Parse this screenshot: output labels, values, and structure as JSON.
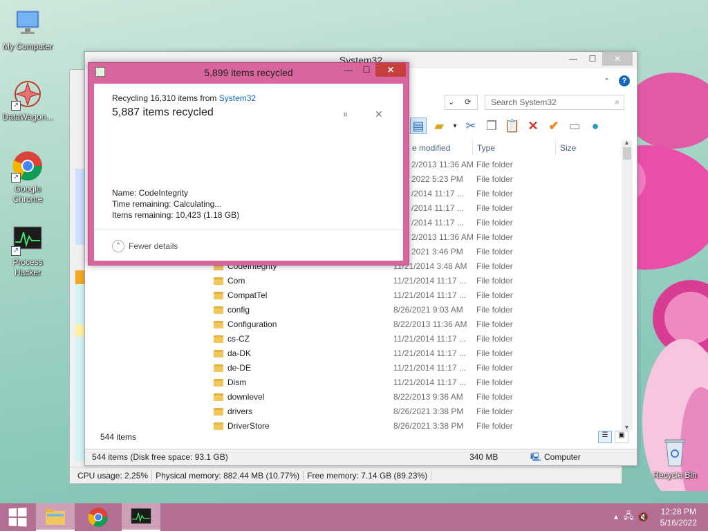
{
  "desktop": {
    "icons": [
      {
        "label": "My Computer",
        "icon": "computer-icon"
      },
      {
        "label": "DataWagon...",
        "icon": "datawagon-icon"
      },
      {
        "label": "Google Chrome",
        "icon": "chrome-icon"
      },
      {
        "label": "Process Hacker",
        "icon": "process-hacker-icon"
      },
      {
        "label": "Recycle Bin",
        "icon": "recycle-bin-icon"
      }
    ]
  },
  "process_hacker": {
    "status": {
      "cpu": "CPU usage: 2.25%",
      "physical": "Physical memory: 882.44 MB (10.77%)",
      "free": "Free memory: 7.14 GB (89.23%)"
    }
  },
  "explorer": {
    "title": "System32",
    "search_placeholder": "Search System32",
    "columns": {
      "modified": "e modified",
      "type": "Type",
      "size": "Size"
    },
    "rows": [
      {
        "name": "",
        "date": "2/2013 11:36 AM",
        "type": "File folder"
      },
      {
        "name": "",
        "date": "2022 5:23 PM",
        "type": "File folder"
      },
      {
        "name": "",
        "date": "/2014 11:17 ...",
        "type": "File folder"
      },
      {
        "name": "",
        "date": "/2014 11:17 ...",
        "type": "File folder"
      },
      {
        "name": "",
        "date": "/2014 11:17 ...",
        "type": "File folder"
      },
      {
        "name": "",
        "date": "2/2013 11:36 AM",
        "type": "File folder"
      },
      {
        "name": "",
        "date": "2021 3:46 PM",
        "type": "File folder"
      },
      {
        "name": "CodeIntegrity",
        "date": "11/21/2014 3:48 AM",
        "type": "File folder"
      },
      {
        "name": "Com",
        "date": "11/21/2014 11:17 ...",
        "type": "File folder"
      },
      {
        "name": "CompatTel",
        "date": "11/21/2014 11:17 ...",
        "type": "File folder"
      },
      {
        "name": "config",
        "date": "8/26/2021 9:03 AM",
        "type": "File folder"
      },
      {
        "name": "Configuration",
        "date": "8/22/2013 11:36 AM",
        "type": "File folder"
      },
      {
        "name": "cs-CZ",
        "date": "11/21/2014 11:17 ...",
        "type": "File folder"
      },
      {
        "name": "da-DK",
        "date": "11/21/2014 11:17 ...",
        "type": "File folder"
      },
      {
        "name": "de-DE",
        "date": "11/21/2014 11:17 ...",
        "type": "File folder"
      },
      {
        "name": "Dism",
        "date": "11/21/2014 11:17 ...",
        "type": "File folder"
      },
      {
        "name": "downlevel",
        "date": "8/22/2013 9:36 AM",
        "type": "File folder"
      },
      {
        "name": "drivers",
        "date": "8/26/2021 3:38 PM",
        "type": "File folder"
      },
      {
        "name": "DriverStore",
        "date": "8/26/2021 3:38 PM",
        "type": "File folder"
      }
    ],
    "item_count": "544 items",
    "status": {
      "left": "544 items (Disk free space: 93.1 GB)",
      "size": "340 MB",
      "location": "Computer"
    }
  },
  "dialog": {
    "title": "5,899 items recycled",
    "recycling_prefix": "Recycling 16,310 items from ",
    "recycling_link": "System32",
    "progress_text": "5,887 items recycled",
    "name": "Name:  CodeIntegrity",
    "time": "Time remaining:  Calculating...",
    "items": "Items remaining:  10,423 (1.18 GB)",
    "fewer": "Fewer details"
  },
  "taskbar": {
    "time": "12:28 PM",
    "date": "5/16/2022"
  },
  "colors": {
    "dialog_frame": "#d9659f",
    "taskbar": "#b26e93",
    "link": "#1a66b8"
  }
}
